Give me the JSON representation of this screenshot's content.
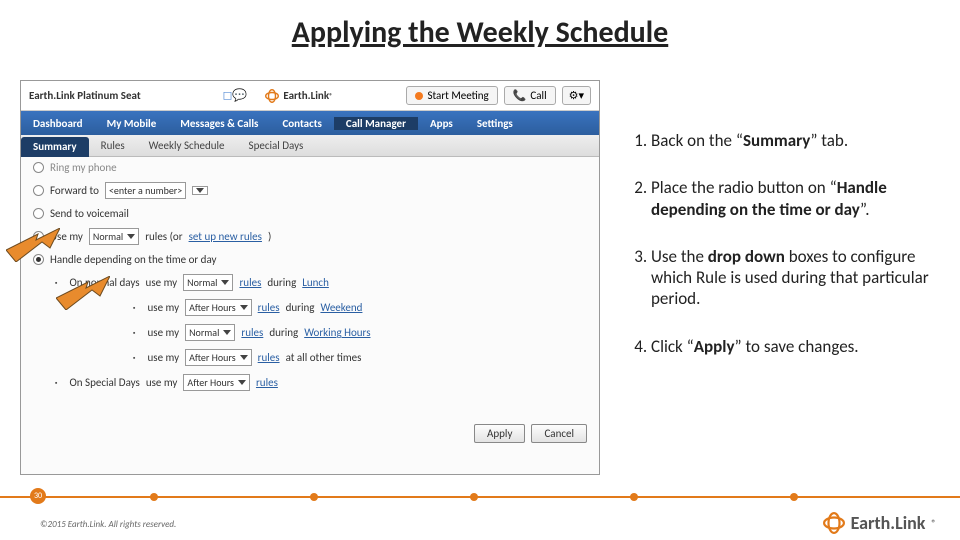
{
  "title": "Applying the Weekly Schedule",
  "header": {
    "seat": "Earth.Link Platinum Seat",
    "brand": "Earth.Link",
    "start_label": "Start Meeting",
    "call_label": "Call",
    "gear_label": "⚙▾"
  },
  "tabs_primary": [
    "Dashboard",
    "My Mobile",
    "Messages & Calls",
    "Contacts",
    "Call Manager",
    "Apps",
    "Settings"
  ],
  "tabs_primary_active": 4,
  "tabs_secondary": [
    "Summary",
    "Rules",
    "Weekly Schedule",
    "Special Days"
  ],
  "tabs_secondary_active": 0,
  "options": {
    "ring": "Ring my phone",
    "forward": "Forward to",
    "forward_value": "<enter a number>",
    "voicemail": "Send to voicemail",
    "usemy": "Use my",
    "usemy_sel": "Normal",
    "rules_text": "rules (or",
    "setup_link": "set up new rules",
    "rules_close": ")",
    "handle": "Handle depending on the time or day",
    "normal_days": "On normal days",
    "special_days": "On Special Days",
    "usemy2": "use my",
    "sel_normal": "Normal",
    "sel_after": "After Hours",
    "rules": "rules",
    "during": "during",
    "lunch": "Lunch",
    "weekend": "Weekend",
    "working": "Working Hours",
    "allother": "at all other times"
  },
  "buttons": {
    "apply": "Apply",
    "cancel": "Cancel"
  },
  "steps_html": [
    "Back on the “<b>Summary</b>” tab.",
    "Place the radio button on “<b>Handle depending on the time or day</b>”.",
    "Use the <b>drop down</b> boxes to configure which Rule is used during that particular period.",
    "Click “<b>Apply</b>” to save changes."
  ],
  "footer": {
    "page": "30",
    "copyright": "©2015 Earth.Link. All rights reserved.",
    "brand": "Earth.Link"
  }
}
